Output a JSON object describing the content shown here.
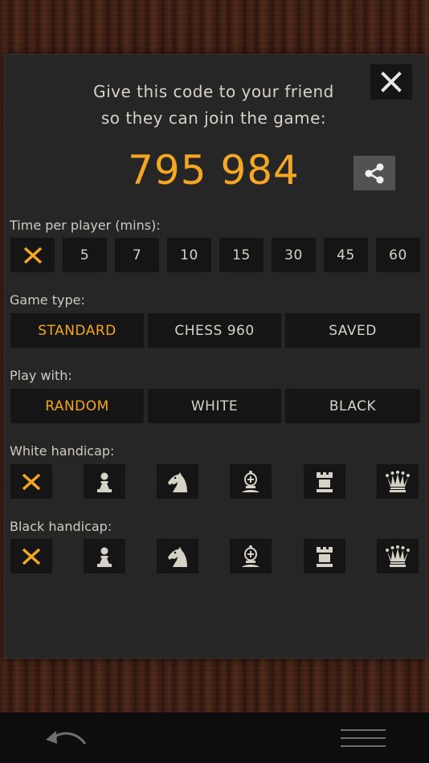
{
  "dialog": {
    "prompt_line1": "Give this code to your friend",
    "prompt_line2": "so they can join the game:",
    "code": "795 984"
  },
  "time": {
    "label": "Time per player (mins):",
    "options": [
      "×",
      "5",
      "7",
      "10",
      "15",
      "30",
      "45",
      "60"
    ],
    "selected_index": 0
  },
  "game_type": {
    "label": "Game type:",
    "options": [
      "STANDARD",
      "CHESS 960",
      "SAVED"
    ],
    "selected_index": 0
  },
  "play_with": {
    "label": "Play with:",
    "options": [
      "RANDOM",
      "WHITE",
      "BLACK"
    ],
    "selected_index": 0
  },
  "white_handicap": {
    "label": "White handicap:",
    "options": [
      "none",
      "pawn-icon",
      "knight-icon",
      "bishop-icon",
      "rook-icon",
      "queen-icon"
    ],
    "selected_index": 0
  },
  "black_handicap": {
    "label": "Black handicap:",
    "options": [
      "none",
      "pawn-icon",
      "knight-icon",
      "bishop-icon",
      "rook-icon",
      "queen-icon"
    ],
    "selected_index": 0
  },
  "colors": {
    "accent": "#f5a623",
    "text": "#d6d2c8",
    "button_bg": "#151515",
    "panel_bg": "#262626"
  }
}
